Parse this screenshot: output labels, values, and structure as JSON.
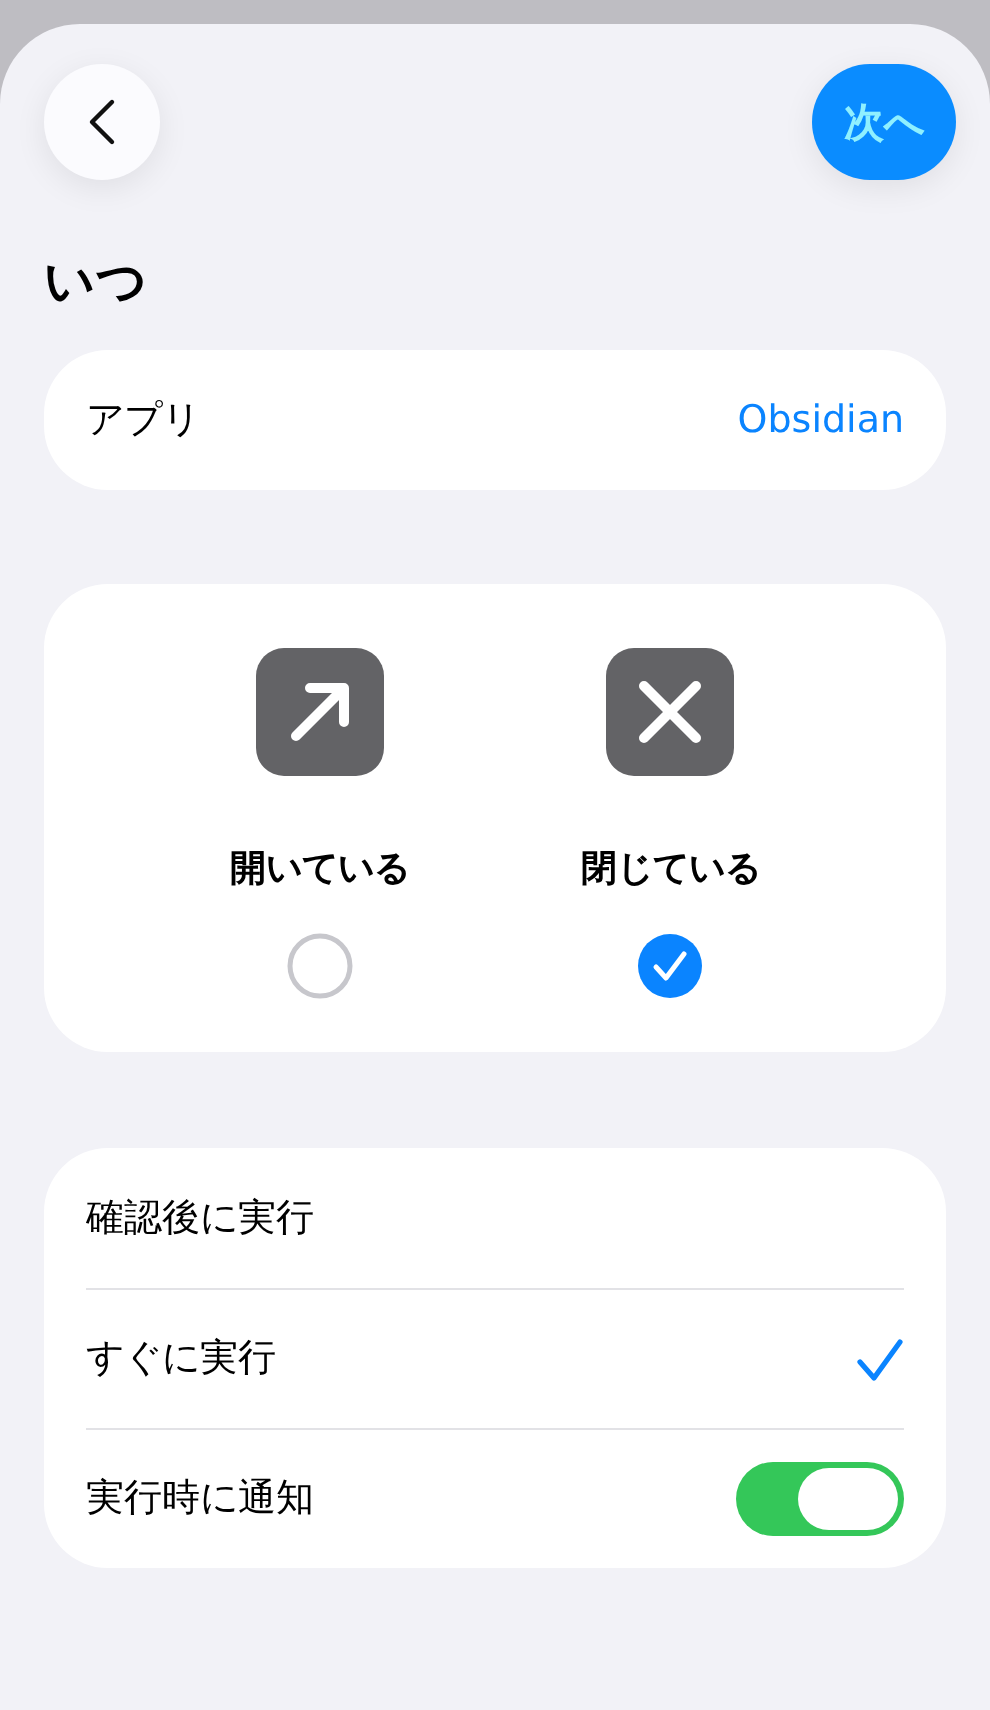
{
  "header": {
    "next_button": "次へ"
  },
  "title": "いつ",
  "app_row": {
    "label": "アプリ",
    "value": "Obsidian"
  },
  "states": [
    {
      "kind": "open",
      "label": "開いている",
      "selected": false
    },
    {
      "kind": "closed",
      "label": "閉じている",
      "selected": true
    }
  ],
  "options": [
    {
      "kind": "choice",
      "label": "確認後に実行",
      "selected": false
    },
    {
      "kind": "choice",
      "label": "すぐに実行",
      "selected": true
    },
    {
      "kind": "toggle",
      "label": "実行時に通知",
      "on": true
    }
  ]
}
